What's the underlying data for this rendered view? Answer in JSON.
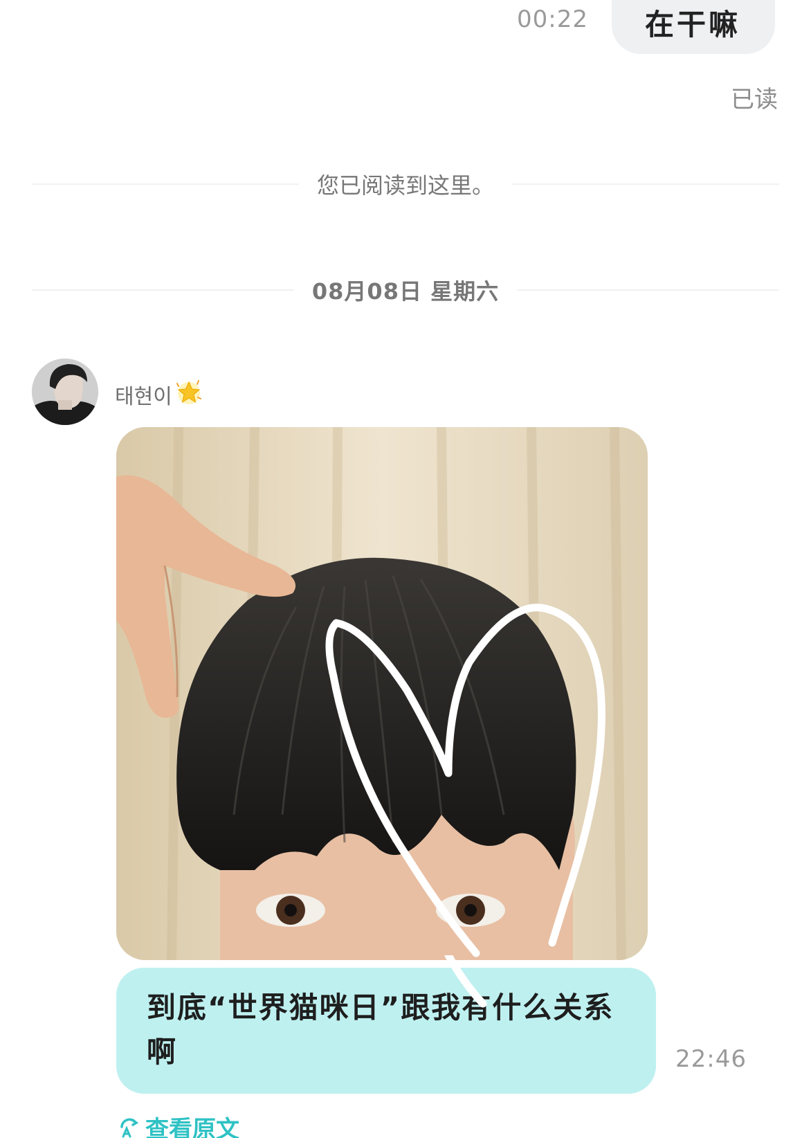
{
  "colors": {
    "incoming_bubble": "#bff0f0",
    "outgoing_bubble": "#eff0f2",
    "accent": "#2fc2c4",
    "muted_text": "#9a9a9a"
  },
  "outgoing_message": {
    "time": "00:22",
    "text": "在干嘛",
    "read_status": "已读"
  },
  "read_marker": {
    "text": "您已阅读到这里。"
  },
  "date_divider": {
    "text": "08月08日 星期六"
  },
  "incoming_message": {
    "sender_name": "태현이",
    "sender_badge_icon": "glowing-star-icon",
    "photo_icon": "selfie-photo",
    "text": "到底“世界猫咪日”跟我有什么关系啊",
    "time": "22:46",
    "view_original_label": "查看原文",
    "view_original_icon": "translate-icon"
  }
}
